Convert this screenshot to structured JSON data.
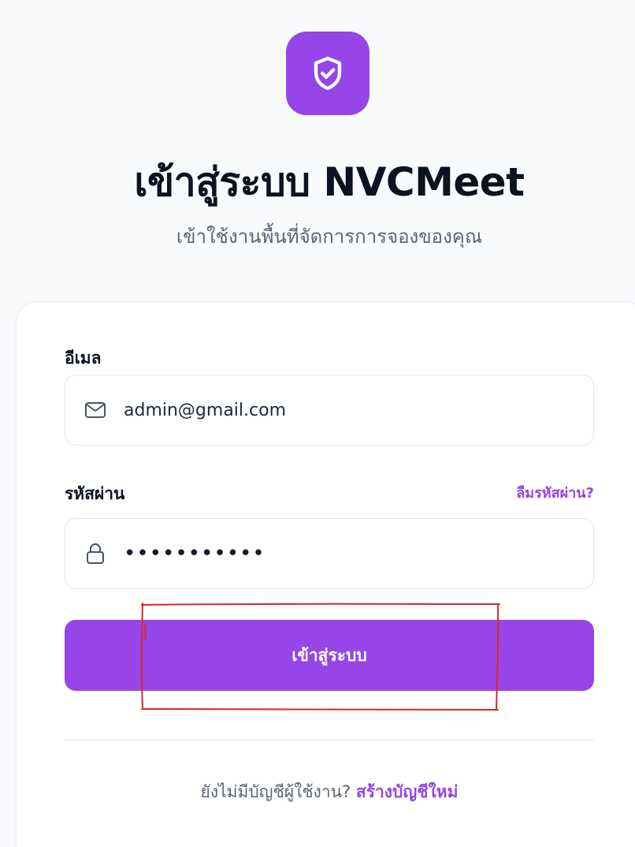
{
  "brand": {
    "accent_color": "#9645e8",
    "logo_icon": "shield-check-icon"
  },
  "header": {
    "title": "เข้าสู่ระบบ NVCMeet",
    "subtitle": "เข้าใช้งานพื้นที่จัดการการจองของคุณ"
  },
  "form": {
    "email": {
      "label": "อีเมล",
      "icon": "mail-icon",
      "value": "admin@gmail.com"
    },
    "password": {
      "label": "รหัสผ่าน",
      "icon": "lock-icon",
      "masked_value": "•••••••••••",
      "forgot_label": "ลืมรหัสผ่าน?"
    },
    "submit_label": "เข้าสู่ระบบ"
  },
  "footer": {
    "prompt": "ยังไม่มีบัญชีผู้ใช้งาน?",
    "signup_label": "สร้างบัญชีใหม่"
  },
  "annotation": {
    "color": "#d62828"
  }
}
